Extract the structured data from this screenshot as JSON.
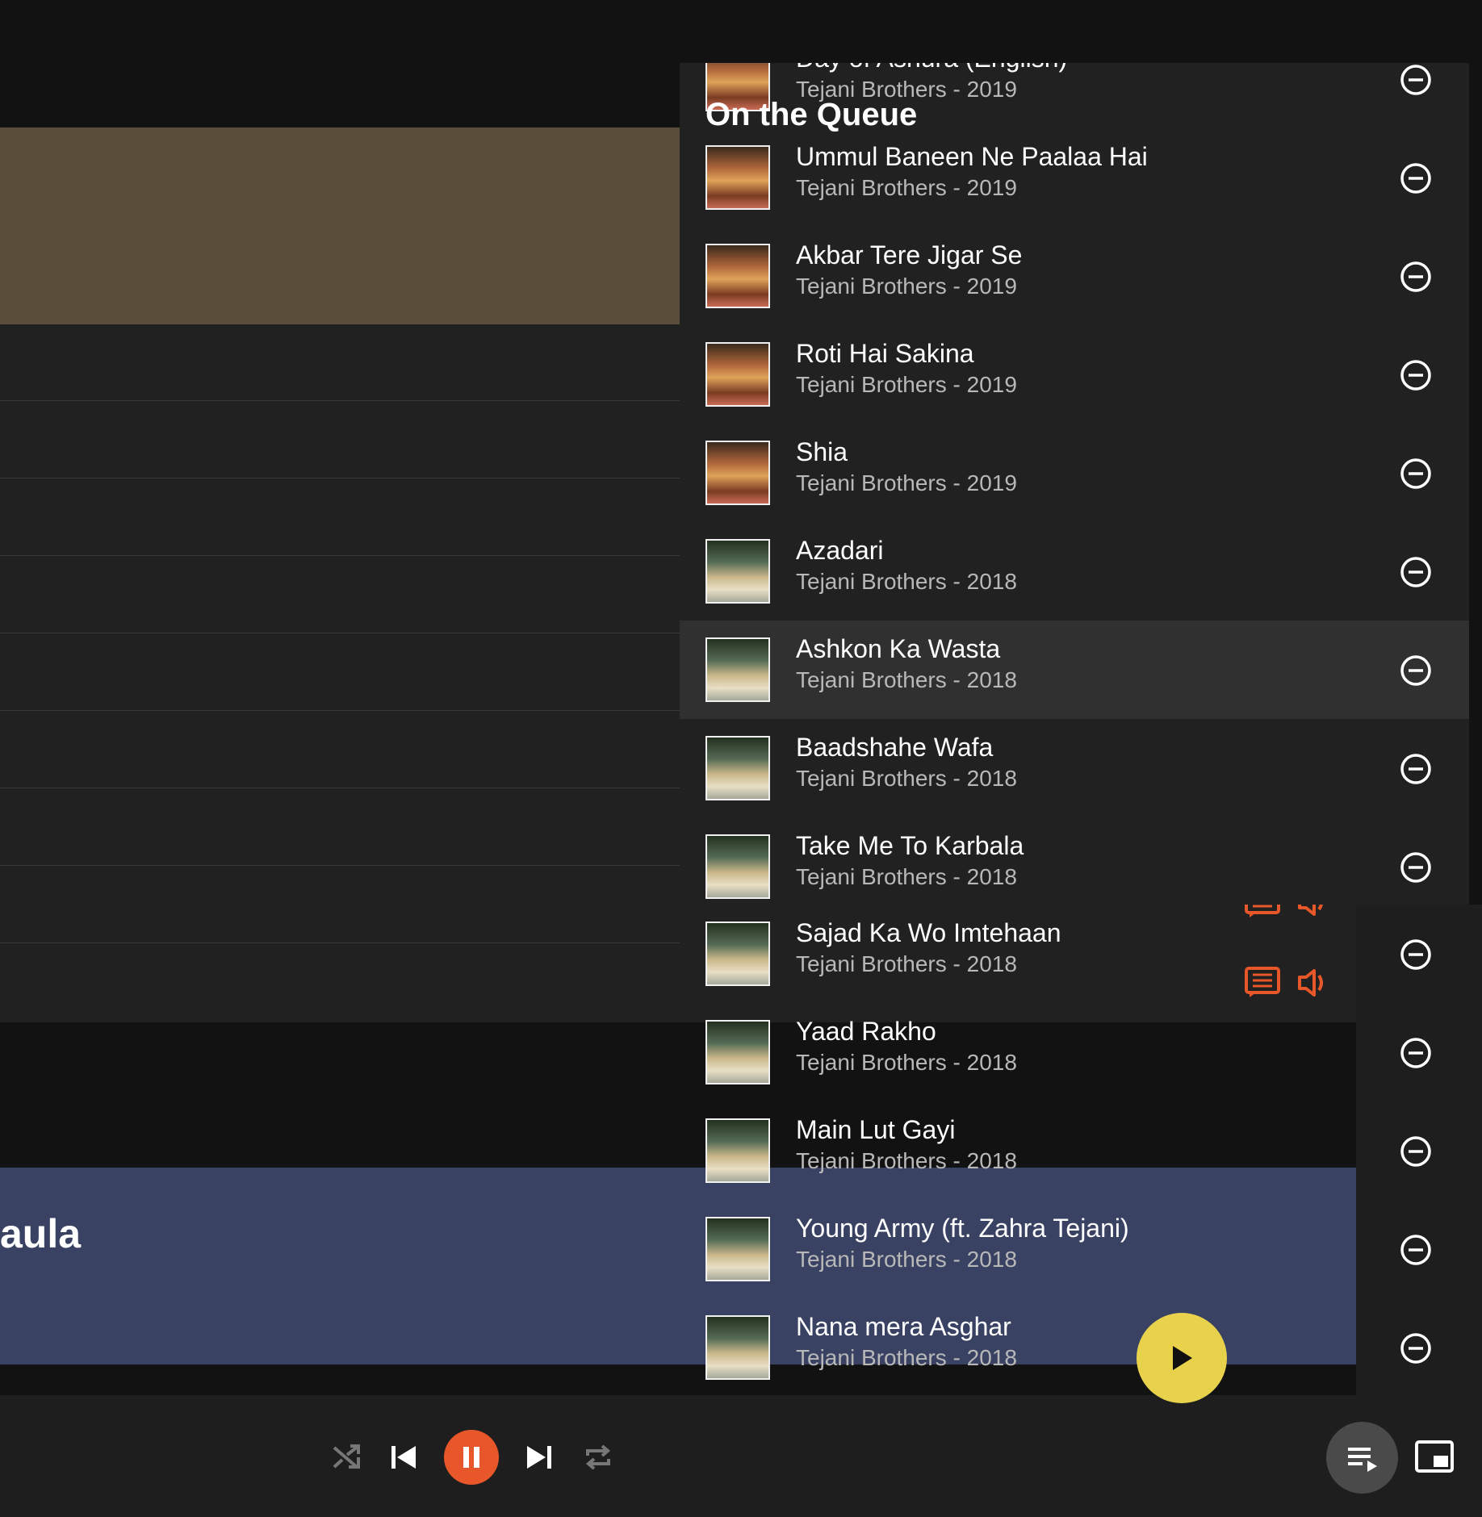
{
  "colors": {
    "accent": "#e8572a",
    "fab": "#e8d24b",
    "panel": "#212121",
    "highlight": "#303030",
    "header_brown": "#5a4e3b",
    "now_playing_blue": "#3a4263"
  },
  "background": {
    "partial_title": "aula"
  },
  "queue": {
    "heading": "On the Queue",
    "items": [
      {
        "title": "Day of Ashura (English)",
        "subtitle": "Tejani Brothers - 2019",
        "art": "a"
      },
      {
        "title": "Ummul Baneen Ne Paalaa Hai",
        "subtitle": "Tejani Brothers - 2019",
        "art": "a"
      },
      {
        "title": "Akbar Tere Jigar Se",
        "subtitle": "Tejani Brothers - 2019",
        "art": "a"
      },
      {
        "title": "Roti Hai Sakina",
        "subtitle": "Tejani Brothers - 2019",
        "art": "a"
      },
      {
        "title": "Shia",
        "subtitle": "Tejani Brothers - 2019",
        "art": "a"
      },
      {
        "title": "Azadari",
        "subtitle": "Tejani Brothers - 2018",
        "art": "b"
      },
      {
        "title": "Ashkon Ka Wasta",
        "subtitle": "Tejani Brothers - 2018",
        "art": "b"
      },
      {
        "title": "Baadshahe Wafa",
        "subtitle": "Tejani Brothers - 2018",
        "art": "b"
      },
      {
        "title": "Take Me To Karbala",
        "subtitle": "Tejani Brothers - 2018",
        "art": "b"
      },
      {
        "title": "Sajad Ka Wo Imtehaan",
        "subtitle": "Tejani Brothers - 2018",
        "art": "b"
      },
      {
        "title": "Yaad Rakho",
        "subtitle": "Tejani Brothers - 2018",
        "art": "b"
      },
      {
        "title": "Main Lut Gayi",
        "subtitle": "Tejani Brothers - 2018",
        "art": "b"
      },
      {
        "title": "Young Army (ft. Zahra Tejani)",
        "subtitle": "Tejani Brothers - 2018",
        "art": "b"
      },
      {
        "title": "Nana mera Asghar",
        "subtitle": "Tejani Brothers - 2018",
        "art": "b"
      }
    ]
  },
  "icons": {
    "remove": "remove-circle-icon",
    "lyrics": "lyrics-icon",
    "volume": "volume-icon",
    "shuffle": "shuffle-icon",
    "previous": "skip-previous-icon",
    "pause": "pause-icon",
    "next": "skip-next-icon",
    "repeat": "repeat-icon",
    "queue": "queue-music-icon",
    "miniplayer": "picture-in-picture-icon",
    "play": "play-icon"
  }
}
